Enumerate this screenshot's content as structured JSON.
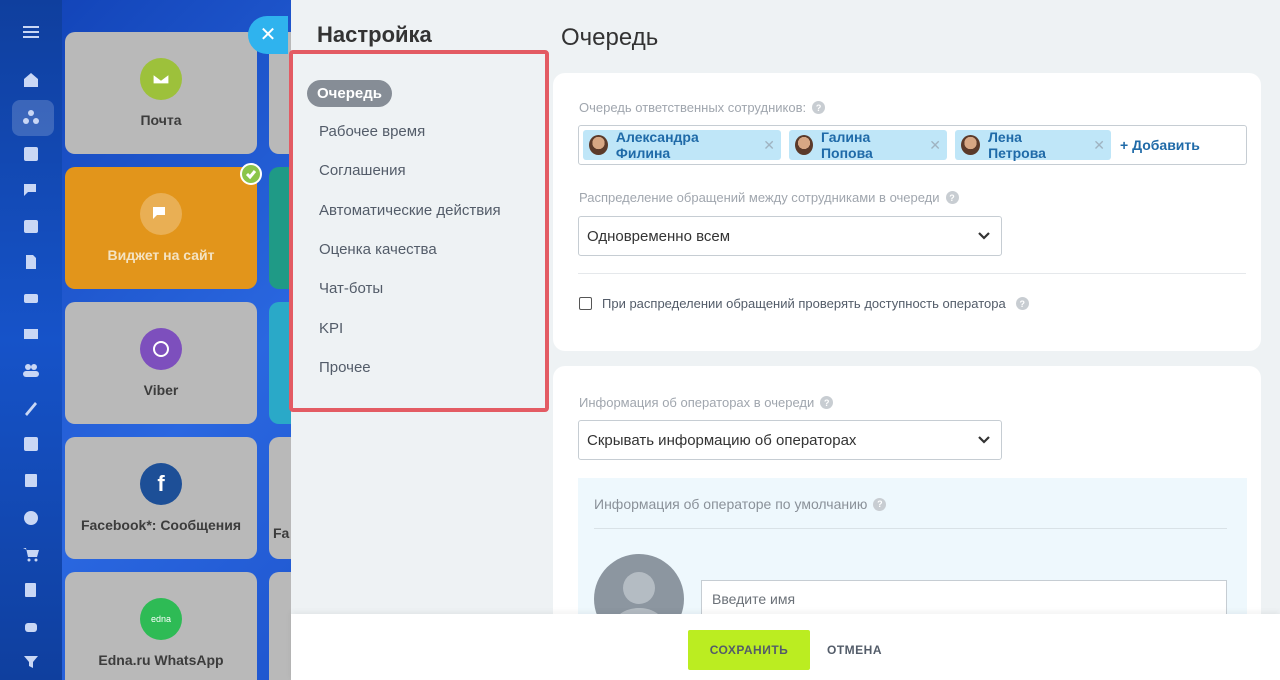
{
  "tiles": [
    {
      "label": "Почта",
      "icon": "mail-icon",
      "color": "#9dc13b"
    },
    {
      "label": "Виджет на сайт",
      "icon": "chat-icon",
      "color": "#e2951b"
    },
    {
      "label": "Viber",
      "icon": "viber-icon",
      "color": "#7d4fbd"
    },
    {
      "label": "Facebook*: Сообщения",
      "icon": "facebook-icon",
      "color": "#1d4f97"
    },
    {
      "label": "Edna.ru WhatsApp",
      "icon": "edna-icon",
      "color": "#2ebb55"
    }
  ],
  "tile_peek_text": [
    "Fa"
  ],
  "edna_logo_text": "edna",
  "settings": {
    "title": "Настройка",
    "nav": [
      "Очередь",
      "Рабочее время",
      "Соглашения",
      "Автоматические действия",
      "Оценка качества",
      "Чат-боты",
      "KPI",
      "Прочее"
    ],
    "active_nav": "Очередь"
  },
  "main": {
    "title": "Очередь",
    "queue_label": "Очередь ответственных сотрудников:",
    "employees": [
      "Александра Филина",
      "Галина Попова",
      "Лена Петрова"
    ],
    "add_label": "+ Добавить",
    "distribution_label": "Распределение обращений между сотрудниками в очереди",
    "distribution_value": "Одновременно всем",
    "availability_check_label": "При распределении обращений проверять доступность оператора",
    "availability_checked": false,
    "operator_info_label": "Информация об операторах в очереди",
    "operator_info_value": "Скрывать информацию об операторах",
    "default_operator_label": "Информация об операторе по умолчанию",
    "name_placeholder": "Введите имя"
  },
  "footer": {
    "save": "СОХРАНИТЬ",
    "cancel": "ОТМЕНА"
  },
  "colors": {
    "accent_save": "#bbed21",
    "highlight_border": "#e35b63",
    "chip_bg": "#bfe6f8",
    "sidebar": "#1653c9"
  }
}
